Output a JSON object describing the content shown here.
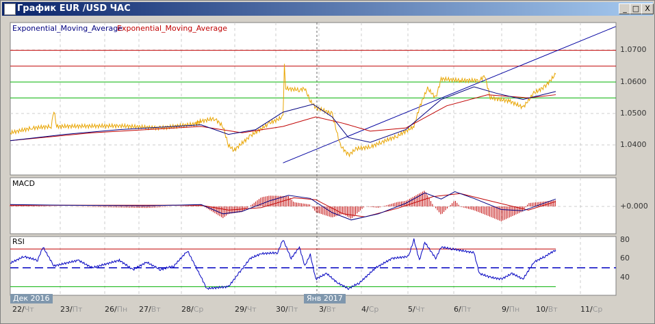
{
  "window": {
    "title": "График EUR /USD  ЧАС",
    "min": "_",
    "max": "□",
    "close": "X"
  },
  "legend": {
    "ema1": "Exponential_Moving_Average",
    "ema2": "Exponential_Moving_Average",
    "macd": "MACD",
    "rsi": "RSI"
  },
  "colors": {
    "price": "#e8a400",
    "ema_fast": "#000080",
    "ema_slow": "#c00000",
    "rsi": "#0000c0",
    "green": "#00b000",
    "red": "#c00000"
  },
  "price_axis": [
    "1.0700",
    "1.0600",
    "1.0500",
    "1.0400"
  ],
  "macd_axis": [
    "+0.000"
  ],
  "rsi_axis": [
    "80",
    "60",
    "40"
  ],
  "month_tags": [
    "Дек 2016",
    "Янв 2017"
  ],
  "dates": [
    [
      "22/",
      "Чт"
    ],
    [
      "23/",
      "Пт"
    ],
    [
      "26/",
      "Пн"
    ],
    [
      "27/",
      "Вт"
    ],
    [
      "28/",
      "Ср"
    ],
    [
      "29/",
      "Чт"
    ],
    [
      "30/",
      "Пт"
    ],
    [
      "3/",
      "Вт"
    ],
    [
      "4/",
      "Ср"
    ],
    [
      "5/",
      "Чт"
    ],
    [
      "6/",
      "Пт"
    ],
    [
      "9/",
      "Пн"
    ],
    [
      "10/",
      "Вт"
    ],
    [
      "11/",
      "Ср"
    ]
  ],
  "chart_data": {
    "type": "line",
    "levels": {
      "red": [
        1.07,
        1.065
      ],
      "green": [
        1.06,
        1.055
      ]
    },
    "trendline": [
      [
        100,
        1.0345
      ],
      [
        222,
        1.0775
      ]
    ],
    "price": [
      [
        0,
        1.044
      ],
      [
        8,
        1.0455
      ],
      [
        15,
        1.046
      ],
      [
        16,
        1.051
      ],
      [
        17,
        1.046
      ],
      [
        40,
        1.0462
      ],
      [
        55,
        1.0455
      ],
      [
        70,
        1.047
      ],
      [
        68,
        1.047
      ],
      [
        69,
        1.0475
      ],
      [
        75,
        1.0485
      ],
      [
        78,
        1.046
      ],
      [
        80,
        1.04
      ],
      [
        82,
        1.0385
      ],
      [
        88,
        1.043
      ],
      [
        95,
        1.047
      ],
      [
        100,
        1.049
      ],
      [
        100.5,
        1.0655
      ],
      [
        101,
        1.058
      ],
      [
        106,
        1.0575
      ],
      [
        108,
        1.058
      ],
      [
        110,
        1.054
      ],
      [
        112,
        1.052
      ],
      [
        118,
        1.05
      ],
      [
        121,
        1.04
      ],
      [
        124,
        1.037
      ],
      [
        127,
        1.039
      ],
      [
        132,
        1.0395
      ],
      [
        136,
        1.041
      ],
      [
        142,
        1.043
      ],
      [
        148,
        1.046
      ],
      [
        150,
        1.052
      ],
      [
        153,
        1.058
      ],
      [
        156,
        1.055
      ],
      [
        158,
        1.061
      ],
      [
        165,
        1.0605
      ],
      [
        172,
        1.0605
      ],
      [
        174,
        1.062
      ],
      [
        176,
        1.055
      ],
      [
        183,
        1.054
      ],
      [
        188,
        1.052
      ],
      [
        192,
        1.0565
      ],
      [
        196,
        1.0585
      ],
      [
        200,
        1.0625
      ]
    ],
    "ema_fast": [
      [
        0,
        1.0415
      ],
      [
        20,
        1.0435
      ],
      [
        40,
        1.045
      ],
      [
        70,
        1.0465
      ],
      [
        80,
        1.0435
      ],
      [
        90,
        1.045
      ],
      [
        100,
        1.0505
      ],
      [
        111,
        1.053
      ],
      [
        118,
        1.049
      ],
      [
        124,
        1.0425
      ],
      [
        132,
        1.041
      ],
      [
        145,
        1.045
      ],
      [
        158,
        1.0545
      ],
      [
        170,
        1.0585
      ],
      [
        178,
        1.0565
      ],
      [
        188,
        1.0545
      ],
      [
        200,
        1.057
      ]
    ],
    "ema_slow": [
      [
        0,
        1.0415
      ],
      [
        30,
        1.044
      ],
      [
        70,
        1.046
      ],
      [
        85,
        1.044
      ],
      [
        100,
        1.046
      ],
      [
        112,
        1.049
      ],
      [
        122,
        1.047
      ],
      [
        132,
        1.0445
      ],
      [
        145,
        1.0455
      ],
      [
        160,
        1.0525
      ],
      [
        175,
        1.056
      ],
      [
        190,
        1.055
      ],
      [
        200,
        1.056
      ]
    ],
    "macd": [
      [
        0,
        0.0003
      ],
      [
        20,
        0.0002
      ],
      [
        50,
        0.0001
      ],
      [
        70,
        0.0003
      ],
      [
        78,
        -0.0012
      ],
      [
        85,
        -0.0008
      ],
      [
        95,
        0.0009
      ],
      [
        102,
        0.0018
      ],
      [
        110,
        0.0013
      ],
      [
        118,
        -0.001
      ],
      [
        125,
        -0.0022
      ],
      [
        135,
        -0.0012
      ],
      [
        145,
        0.0005
      ],
      [
        152,
        0.0022
      ],
      [
        158,
        0.0012
      ],
      [
        163,
        0.0024
      ],
      [
        170,
        0.0013
      ],
      [
        180,
        -0.0005
      ],
      [
        188,
        -0.0007
      ],
      [
        200,
        0.0012
      ]
    ],
    "signal": [
      [
        0,
        0.0002
      ],
      [
        30,
        0.0002
      ],
      [
        70,
        0.0002
      ],
      [
        80,
        -0.0006
      ],
      [
        92,
        -0.0002
      ],
      [
        104,
        0.0014
      ],
      [
        112,
        0.0011
      ],
      [
        122,
        -0.0012
      ],
      [
        130,
        -0.0017
      ],
      [
        142,
        -0.0003
      ],
      [
        155,
        0.0016
      ],
      [
        165,
        0.0021
      ],
      [
        175,
        0.001
      ],
      [
        190,
        -0.0006
      ],
      [
        200,
        0.0008
      ]
    ],
    "rsi": [
      [
        0,
        55
      ],
      [
        5,
        62
      ],
      [
        10,
        58
      ],
      [
        12,
        72
      ],
      [
        16,
        52
      ],
      [
        25,
        58
      ],
      [
        30,
        50
      ],
      [
        40,
        58
      ],
      [
        45,
        48
      ],
      [
        50,
        56
      ],
      [
        55,
        48
      ],
      [
        60,
        52
      ],
      [
        65,
        68
      ],
      [
        70,
        40
      ],
      [
        72,
        28
      ],
      [
        80,
        30
      ],
      [
        84,
        45
      ],
      [
        88,
        60
      ],
      [
        92,
        65
      ],
      [
        98,
        66
      ],
      [
        100,
        80
      ],
      [
        103,
        60
      ],
      [
        106,
        72
      ],
      [
        108,
        52
      ],
      [
        110,
        64
      ],
      [
        112,
        38
      ],
      [
        116,
        44
      ],
      [
        120,
        34
      ],
      [
        124,
        28
      ],
      [
        128,
        34
      ],
      [
        134,
        50
      ],
      [
        140,
        60
      ],
      [
        146,
        62
      ],
      [
        148,
        80
      ],
      [
        150,
        58
      ],
      [
        152,
        77
      ],
      [
        156,
        60
      ],
      [
        158,
        72
      ],
      [
        162,
        70
      ],
      [
        170,
        66
      ],
      [
        172,
        44
      ],
      [
        176,
        40
      ],
      [
        180,
        38
      ],
      [
        184,
        44
      ],
      [
        188,
        38
      ],
      [
        192,
        56
      ],
      [
        196,
        62
      ],
      [
        200,
        69
      ]
    ]
  }
}
